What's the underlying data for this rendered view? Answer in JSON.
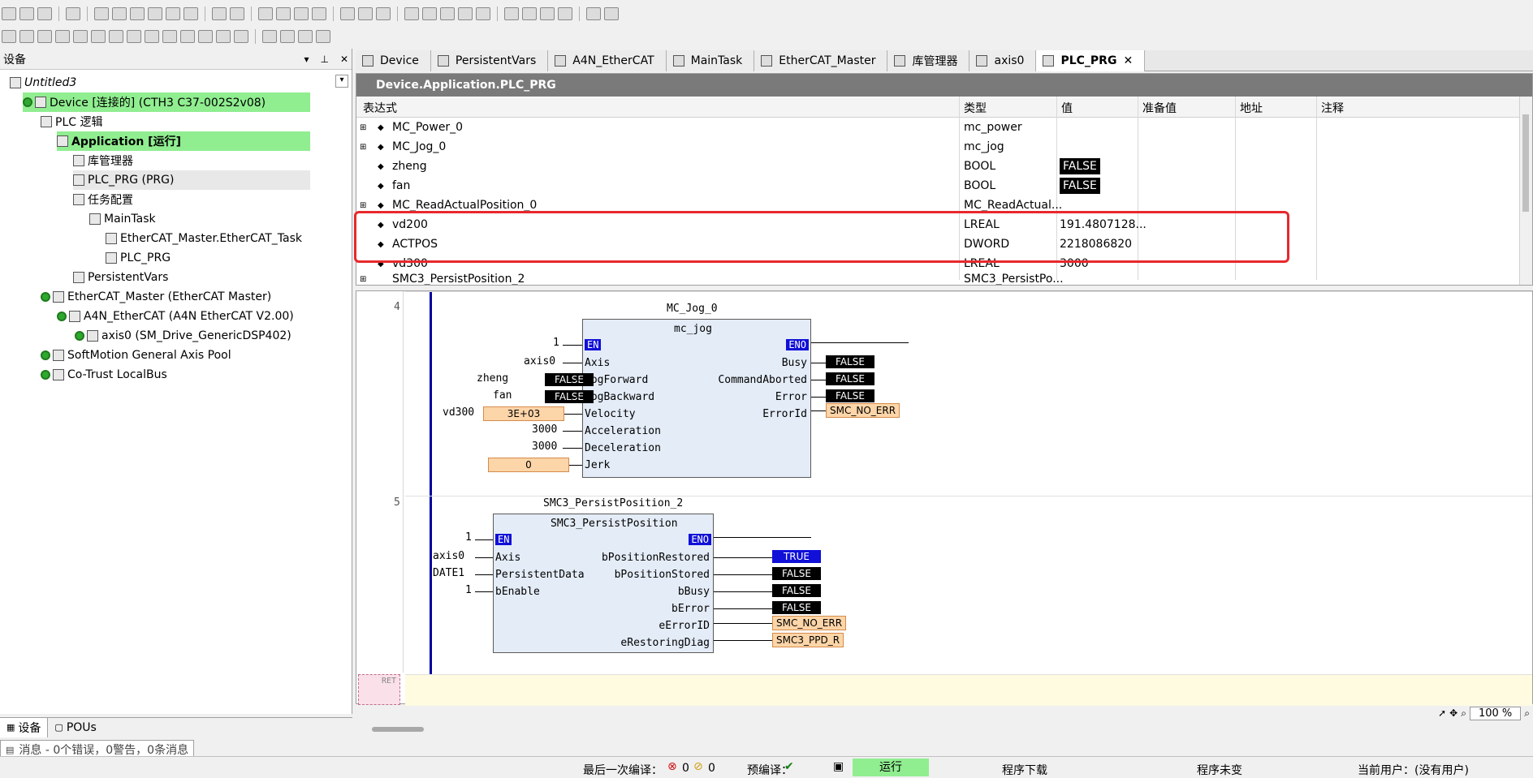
{
  "left_panel": {
    "title": "设备",
    "tree": [
      {
        "label": "Untitled3",
        "italic": true
      },
      {
        "label": "Device [连接的] (CTH3 C37-002S2v08)"
      },
      {
        "label": "PLC 逻辑"
      },
      {
        "label": "Application [运行]"
      },
      {
        "label": "库管理器"
      },
      {
        "label": "PLC_PRG (PRG)"
      },
      {
        "label": "任务配置"
      },
      {
        "label": "MainTask"
      },
      {
        "label": "EtherCAT_Master.EtherCAT_Task"
      },
      {
        "label": "PLC_PRG"
      },
      {
        "label": "PersistentVars"
      },
      {
        "label": "EtherCAT_Master (EtherCAT Master)"
      },
      {
        "label": "A4N_EtherCAT (A4N EtherCAT V2.00)"
      },
      {
        "label": "axis0 (SM_Drive_GenericDSP402)"
      },
      {
        "label": "SoftMotion General Axis Pool"
      },
      {
        "label": "Co-Trust LocalBus"
      }
    ],
    "bottom_tabs": [
      "设备",
      "POUs"
    ]
  },
  "messages_tab": "消息 - 0个错误，0警告，0条消息",
  "tabs": [
    "Device",
    "PersistentVars",
    "A4N_EtherCAT",
    "MainTask",
    "EtherCAT_Master",
    "库管理器",
    "axis0",
    "PLC_PRG"
  ],
  "watch": {
    "title": "Device.Application.PLC_PRG",
    "headers": {
      "expr": "表达式",
      "type": "类型",
      "value": "值",
      "prepared": "准备值",
      "address": "地址",
      "comment": "注释"
    },
    "rows": [
      {
        "expr": "MC_Power_0",
        "type": "mc_power",
        "value": ""
      },
      {
        "expr": "MC_Jog_0",
        "type": "mc_jog",
        "value": ""
      },
      {
        "expr": "zheng",
        "type": "BOOL",
        "value": "FALSE"
      },
      {
        "expr": "fan",
        "type": "BOOL",
        "value": "FALSE"
      },
      {
        "expr": "MC_ReadActualPosition_0",
        "type": "MC_ReadActual...",
        "value": ""
      },
      {
        "expr": "vd200",
        "type": "LREAL",
        "value": "191.4807128..."
      },
      {
        "expr": "ACTPOS",
        "type": "DWORD",
        "value": "2218086820"
      },
      {
        "expr": "vd300",
        "type": "LREAL",
        "value": "3000"
      },
      {
        "expr": "SMC3_PersistPosition_2",
        "type": "SMC3_PersistPo...",
        "value": ""
      }
    ]
  },
  "editor": {
    "net4": {
      "number": "4",
      "instance": "MC_Jog_0",
      "fb": "mc_jog",
      "inputs": [
        {
          "pin": "EN",
          "var": "1"
        },
        {
          "pin": "Axis",
          "var": "axis0"
        },
        {
          "pin": "JogForward",
          "var": "zheng",
          "val": "FALSE"
        },
        {
          "pin": "JogBackward",
          "var": "fan",
          "val": "FALSE"
        },
        {
          "pin": "Velocity",
          "var": "vd300",
          "val": "3E+03"
        },
        {
          "pin": "Acceleration",
          "var": "3000"
        },
        {
          "pin": "Deceleration",
          "var": "3000"
        },
        {
          "pin": "Jerk",
          "var": "0"
        }
      ],
      "outputs": [
        {
          "pin": "ENO"
        },
        {
          "pin": "Busy",
          "val": "FALSE"
        },
        {
          "pin": "CommandAborted",
          "val": "FALSE"
        },
        {
          "pin": "Error",
          "val": "FALSE"
        },
        {
          "pin": "ErrorId",
          "val": "SMC_NO_ERR"
        }
      ]
    },
    "net5": {
      "number": "5",
      "instance": "SMC3_PersistPosition_2",
      "fb": "SMC3_PersistPosition",
      "inputs": [
        {
          "pin": "EN",
          "var": "1"
        },
        {
          "pin": "Axis",
          "var": "axis0"
        },
        {
          "pin": "PersistentData",
          "var": "DATE1"
        },
        {
          "pin": "bEnable",
          "var": "1"
        }
      ],
      "outputs": [
        {
          "pin": "ENO"
        },
        {
          "pin": "bPositionRestored",
          "val": "TRUE"
        },
        {
          "pin": "bPositionStored",
          "val": "FALSE"
        },
        {
          "pin": "bBusy",
          "val": "FALSE"
        },
        {
          "pin": "bError",
          "val": "FALSE"
        },
        {
          "pin": "eErrorID",
          "val": "SMC_NO_ERR"
        },
        {
          "pin": "eRestoringDiag",
          "val": "SMC3_PPD_R"
        }
      ]
    },
    "ret": "RET",
    "zoom": "100 %"
  },
  "status": {
    "last_compile": "最后一次编译：",
    "errors": "0",
    "warnings": "0",
    "precompile": "预编译：",
    "run": "运行",
    "download": "程序下载",
    "unchanged": "程序未变",
    "user": "当前用户：(没有用户)"
  }
}
